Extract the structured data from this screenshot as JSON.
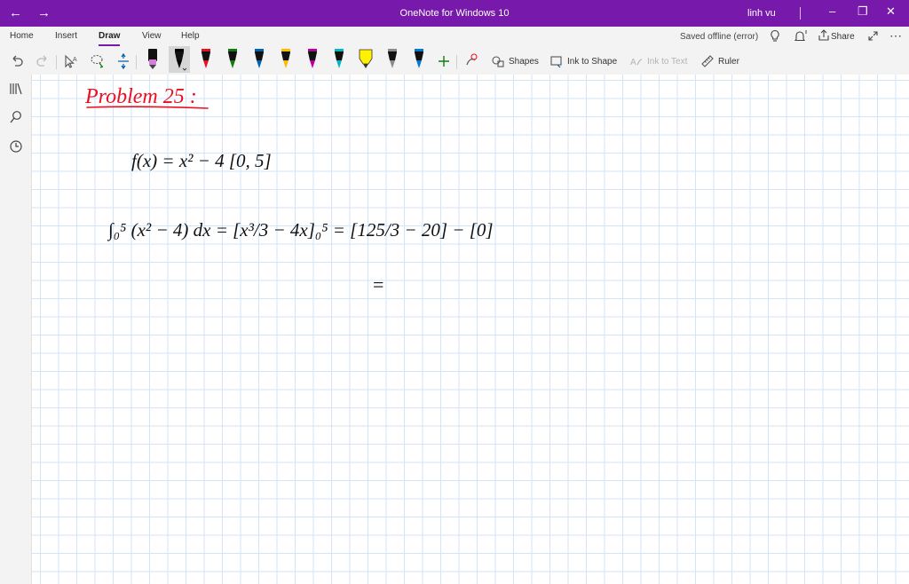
{
  "titlebar": {
    "title": "OneNote for Windows 10",
    "user": "linh vu",
    "back_glyph": "←",
    "forward_glyph": "→",
    "minimize_glyph": "–",
    "restore_glyph": "❐",
    "close_glyph": "✕"
  },
  "ribbon": {
    "tabs": [
      "Home",
      "Insert",
      "Draw",
      "View",
      "Help"
    ],
    "active_tab": "Draw",
    "status": "Saved offline (error)",
    "share_label": "Share",
    "more_glyph": "⋯"
  },
  "tools": {
    "shapes_label": "Shapes",
    "ink_to_shape_label": "Ink to Shape",
    "ink_to_text_label": "Ink to Text",
    "ruler_label": "Ruler",
    "add_pen_glyph": "+"
  },
  "pens": [
    {
      "color": "#000000",
      "type": "pencil"
    },
    {
      "color": "#000000",
      "type": "pen",
      "selected": true
    },
    {
      "color": "#e81123",
      "type": "pen"
    },
    {
      "color": "#107c10",
      "type": "pen"
    },
    {
      "color": "#0063b1",
      "type": "pen"
    },
    {
      "color": "#ffb900",
      "type": "pen"
    },
    {
      "color": "#b4009e",
      "type": "pen"
    },
    {
      "color": "#00b7c3",
      "type": "pen"
    },
    {
      "color": "#fff100",
      "type": "highlighter"
    },
    {
      "color": "#8a8a8a",
      "type": "pen"
    },
    {
      "color": "#0078d4",
      "type": "pen"
    }
  ],
  "colors": {
    "accent": "#7719aa",
    "ink_black": "#111111",
    "ink_red": "#e81123",
    "grid": "#d3e5f7"
  },
  "notes": {
    "heading": "Problem 25 :",
    "function_line": "f(x) = x² − 4    [0, 5]",
    "integral_line": "∫₀⁵ (x² − 4) dx = [x³/3 − 4x]₀⁵ = [125/3 − 20] − [0]",
    "result_line": "="
  }
}
